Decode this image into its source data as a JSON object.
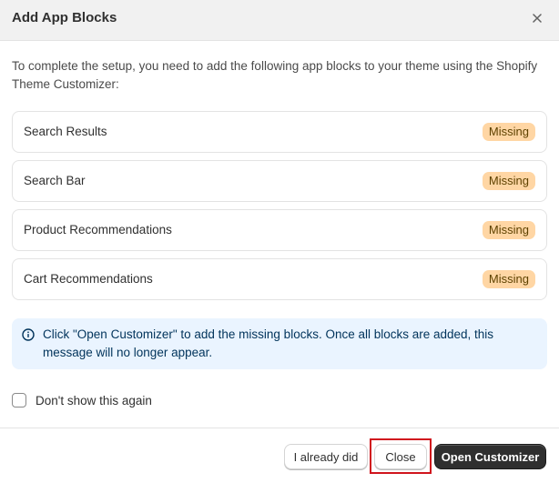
{
  "dialog": {
    "title": "Add App Blocks",
    "close_icon": "close-icon"
  },
  "intro": {
    "text": "To complete the setup, you need to add the following app blocks to your theme using the Shopify Theme Customizer:"
  },
  "blocks": [
    {
      "name": "Search Results",
      "status": "Missing"
    },
    {
      "name": "Search Bar",
      "status": "Missing"
    },
    {
      "name": "Product Recommendations",
      "status": "Missing"
    },
    {
      "name": "Cart Recommendations",
      "status": "Missing"
    }
  ],
  "banner": {
    "icon": "info-icon",
    "text": "Click \"Open Customizer\" to add the missing blocks. Once all blocks are added, this message will no longer appear."
  },
  "checkbox": {
    "label": "Don't show this again",
    "checked": false
  },
  "footer": {
    "already_label": "I already did",
    "close_label": "Close",
    "open_label": "Open Customizer"
  },
  "colors": {
    "badge_bg": "#ffd6a4",
    "banner_bg": "#eaf4ff",
    "primary_button": "#2f2f2f",
    "highlight": "#d0141d"
  }
}
